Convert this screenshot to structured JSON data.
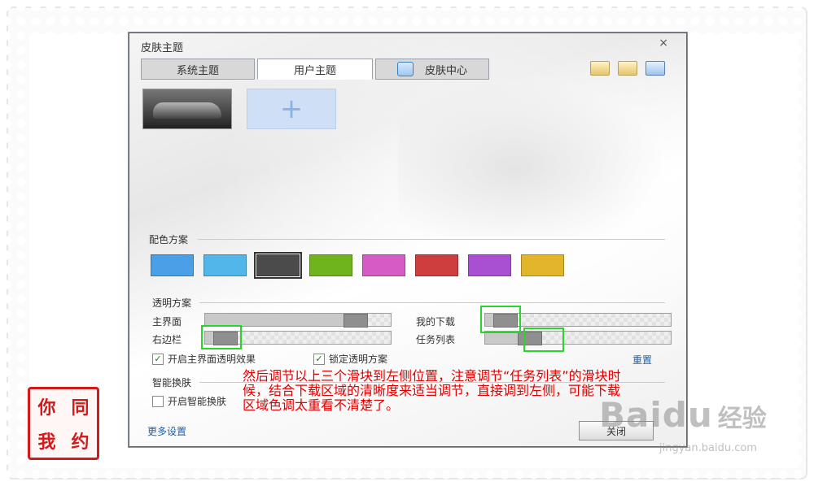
{
  "window": {
    "title": "皮肤主题",
    "close_glyph": "×"
  },
  "tabs": [
    {
      "label": "系统主题",
      "active": false
    },
    {
      "label": "用户主题",
      "active": true
    },
    {
      "label": "皮肤中心",
      "active": false
    }
  ],
  "skins": {
    "add_glyph": "+"
  },
  "color_scheme": {
    "heading": "配色方案",
    "swatches": [
      "#4a9fe6",
      "#52b6ea",
      "#4b4b4b",
      "#6fb31d",
      "#d45cc4",
      "#cf3e3e",
      "#a84fd2",
      "#e2b52a"
    ],
    "selected_index": 2
  },
  "transparency": {
    "heading": "透明方案",
    "main_ui": {
      "label": "主界面",
      "level": 0.85
    },
    "right_bar": {
      "label": "右边栏",
      "level": 0.05
    },
    "my_download": {
      "label": "我的下载",
      "level": 0.05
    },
    "task_list": {
      "label": "任务列表",
      "level": 0.2
    },
    "enable_main_transparency": {
      "label": "开启主界面透明效果",
      "checked": true
    },
    "lock_scheme": {
      "label": "锁定透明方案",
      "checked": true
    },
    "reset_label": "重置"
  },
  "smart_switch": {
    "heading": "智能换肤",
    "enable": {
      "label": "开启智能换肤",
      "checked": false
    }
  },
  "footer": {
    "more_settings": "更多设置",
    "close_button": "关闭"
  },
  "annotation": "然后调节以上三个滑块到左侧位置，注意调节“任务列表”的滑块时候，结合下载区域的清晰度来适当调节，直接调到左侧，可能下载区域色调太重看不清楚了。",
  "stamp": [
    "你",
    "同",
    "我",
    "约"
  ],
  "watermark": {
    "brand": "Baidu",
    "brand_cn": "经验",
    "url": "jingyan.baidu.com"
  }
}
